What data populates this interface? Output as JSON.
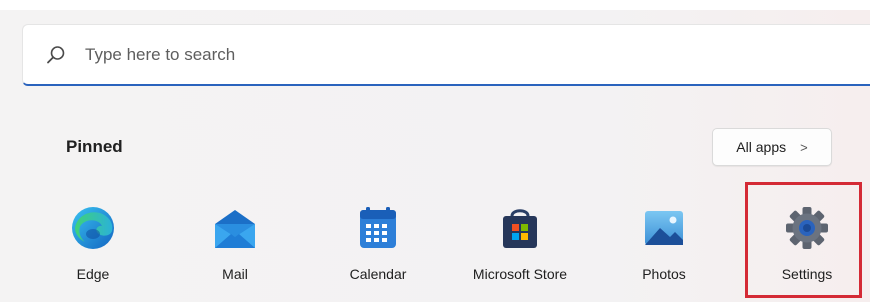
{
  "search": {
    "placeholder": "Type here to search"
  },
  "pinned": {
    "title": "Pinned",
    "all_apps_label": "All apps",
    "all_apps_chevron": ">"
  },
  "apps": [
    {
      "label": "Edge",
      "icon": "edge-icon"
    },
    {
      "label": "Mail",
      "icon": "mail-icon"
    },
    {
      "label": "Calendar",
      "icon": "calendar-icon"
    },
    {
      "label": "Microsoft Store",
      "icon": "store-icon"
    },
    {
      "label": "Photos",
      "icon": "photos-icon"
    },
    {
      "label": "Settings",
      "icon": "settings-icon"
    }
  ],
  "colors": {
    "accent": "#2a63bd",
    "highlight": "#d42a35"
  }
}
